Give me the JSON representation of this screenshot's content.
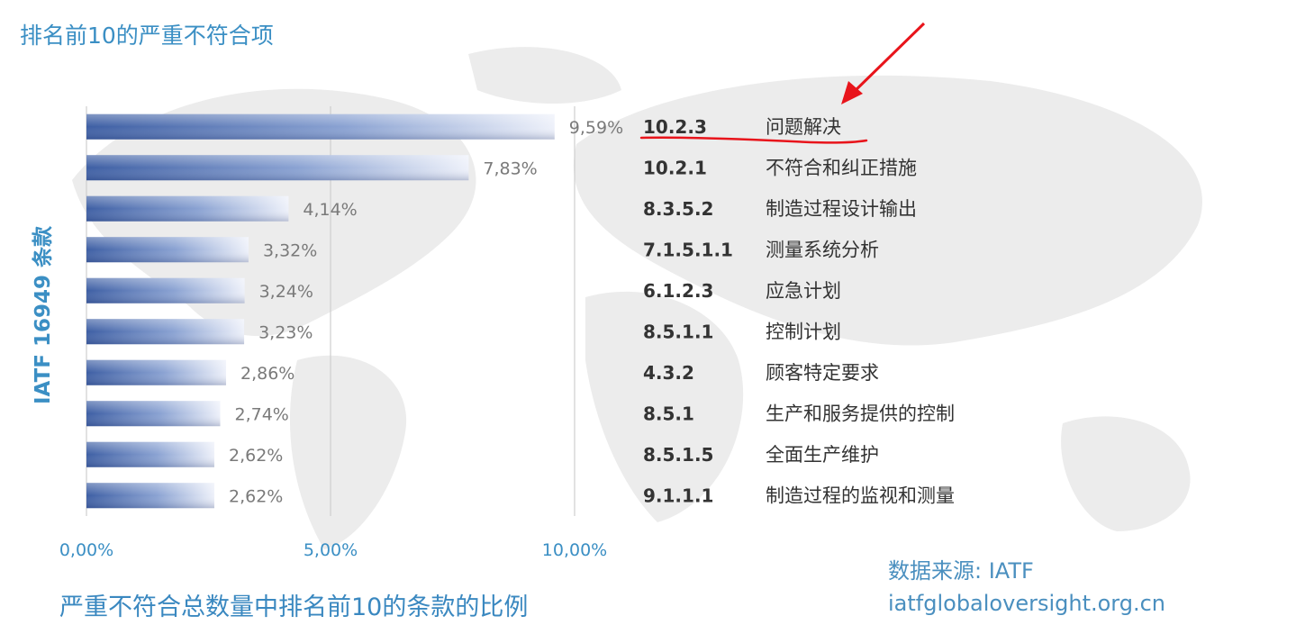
{
  "title": "排名前10的严重不符合项",
  "subtitle": "严重不符合总数量中排名前10的条款的比例",
  "source": {
    "line1": "数据来源: IATF",
    "line2": "iatfglobaloversight.org.cn"
  },
  "colors": {
    "accent": "#3b8fc4",
    "bar_dark": "#3e5fa4",
    "bar_light": "#eef1fa",
    "annotation": "#e8141b"
  },
  "background": "world-map-watermark",
  "annotation": {
    "type": "red-arrow-and-underline",
    "target_clause": "10.2.3"
  },
  "chart_data": {
    "type": "bar",
    "orientation": "horizontal",
    "title": "排名前10的严重不符合项",
    "ylabel": "IATF 16949 条款",
    "xlim": [
      0,
      10
    ],
    "xticks": [
      0,
      5,
      10
    ],
    "xtick_labels": [
      "0,00%",
      "5,00%",
      "10,00%"
    ],
    "grid": true,
    "categories": [
      "10.2.3",
      "10.2.1",
      "8.3.5.2",
      "7.1.5.1.1",
      "6.1.2.3",
      "8.5.1.1",
      "4.3.2",
      "8.5.1",
      "8.5.1.5",
      "9.1.1.1"
    ],
    "descriptions": [
      "问题解决",
      "不符合和纠正措施",
      "制造过程设计输出",
      "测量系统分析",
      "应急计划",
      "控制计划",
      "顾客特定要求",
      "生产和服务提供的控制",
      "全面生产维护",
      "制造过程的监视和测量"
    ],
    "values": [
      9.59,
      7.83,
      4.14,
      3.32,
      3.24,
      3.23,
      2.86,
      2.74,
      2.62,
      2.62
    ],
    "value_labels": [
      "9,59%",
      "7,83%",
      "4,14%",
      "3,32%",
      "3,24%",
      "3,23%",
      "2,86%",
      "2,74%",
      "2,62%",
      "2,62%"
    ]
  }
}
